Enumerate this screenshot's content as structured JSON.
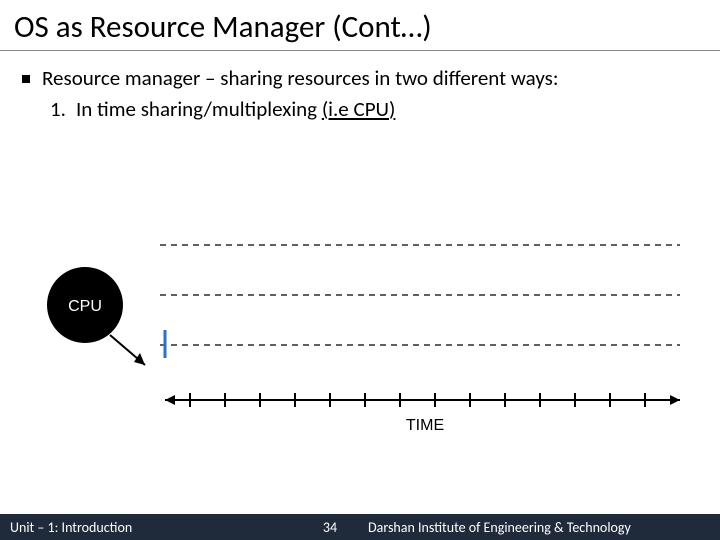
{
  "title": "OS as Resource Manager (Cont…)",
  "bullet": "Resource manager – sharing resources in two different ways:",
  "sub_num": "1.",
  "sub_text_a": "  In time sharing/multiplexing ",
  "sub_text_b": "(i.e CPU)",
  "cpu_label": "CPU",
  "time_label": "TIME",
  "footer": {
    "left": "Unit – 1: Introduction",
    "page": "34",
    "right": "Darshan Institute of Engineering & Technology"
  }
}
